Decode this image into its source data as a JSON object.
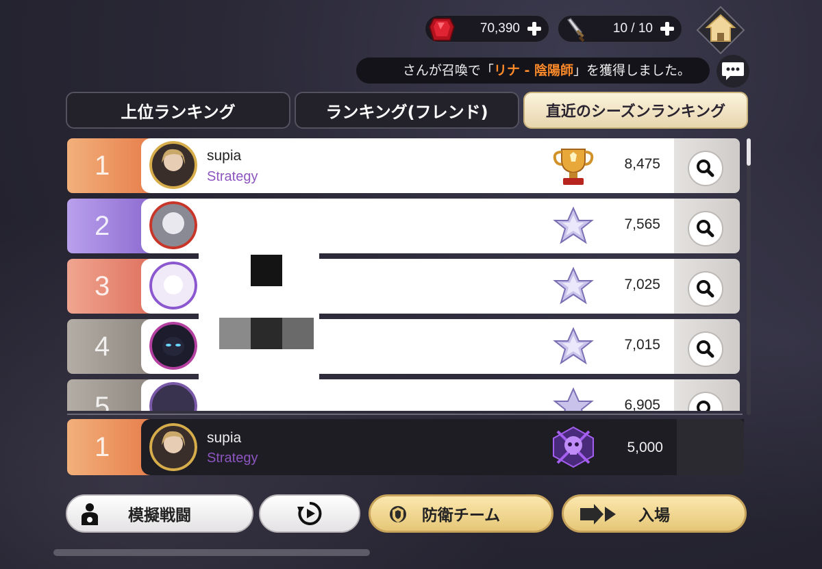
{
  "header": {
    "gems": "70,390",
    "stamina": "10 / 10"
  },
  "notice": {
    "prefix": "さんが召喚で「",
    "highlight": "リナ - 陰陽師",
    "suffix": "」を獲得しました。"
  },
  "tabs": [
    {
      "label": "上位ランキング",
      "active": false
    },
    {
      "label": "ランキング(フレンド)",
      "active": false
    },
    {
      "label": "直近のシーズンランキング",
      "active": true
    }
  ],
  "rankings": [
    {
      "rank": "1",
      "name": "supia",
      "guild": "Strategy",
      "score": "8,475",
      "tier": "gold-trophy",
      "rank_color": "#e8955a"
    },
    {
      "rank": "2",
      "name": "",
      "guild": "",
      "score": "7,565",
      "tier": "silver-star",
      "rank_color": "#9b7fd6"
    },
    {
      "rank": "3",
      "name": "",
      "guild": "",
      "score": "7,025",
      "tier": "silver-star",
      "rank_color": "#e57c6a"
    },
    {
      "rank": "4",
      "name": "",
      "guild": "",
      "score": "7,015",
      "tier": "silver-star",
      "rank_color": "#9a948c"
    },
    {
      "rank": "5",
      "name": "",
      "guild": "",
      "score": "6,905",
      "tier": "silver-star",
      "rank_color": "#9a948c"
    }
  ],
  "my_rank": {
    "rank": "1",
    "name": "supia",
    "guild": "Strategy",
    "score": "5,000",
    "tier": "purple-skull"
  },
  "buttons": {
    "mock_battle": "模擬戦闘",
    "defense_team": "防衛チーム",
    "enter": "入場"
  },
  "colors": {
    "highlight": "#ff8a2a",
    "guild": "#8c55bf",
    "gold_button": "#e6c778"
  }
}
